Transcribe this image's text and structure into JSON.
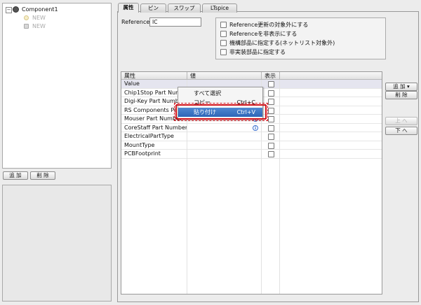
{
  "tree": {
    "root_label": "Component1",
    "children": [
      "NEW",
      "NEW"
    ]
  },
  "left_buttons": {
    "add": "追 加",
    "delete": "削 除"
  },
  "tabs": [
    {
      "label": "属性",
      "active": true
    },
    {
      "label": "ピン",
      "active": false
    },
    {
      "label": "スワップ",
      "active": false
    },
    {
      "label": "LTspice",
      "active": false
    }
  ],
  "reference": {
    "label": "Reference",
    "value": "IC"
  },
  "options": [
    "Reference更新の対象外にする",
    "Referenceを非表示にする",
    "機構部品に指定する(ネットリスト対象外)",
    "非実装部品に指定する"
  ],
  "table": {
    "headers": [
      "属性",
      "値",
      "表示"
    ],
    "rows": [
      {
        "name": "Value",
        "info": false
      },
      {
        "name": "Chip1Stop Part Number",
        "info": false
      },
      {
        "name": "Digi-Key Part Number",
        "info": false
      },
      {
        "name": "RS Components Part Number",
        "info": true
      },
      {
        "name": "Mouser Part Number",
        "info": true
      },
      {
        "name": "CoreStaff Part Number",
        "info": true
      },
      {
        "name": "ElectricalPartType",
        "info": false
      },
      {
        "name": "MountType",
        "info": false
      },
      {
        "name": "PCBFootprint",
        "info": false
      }
    ]
  },
  "right_buttons": {
    "add": "追 加 ▾",
    "delete": "削 除",
    "up": "上 へ",
    "down": "下 へ"
  },
  "context_menu": {
    "items": [
      {
        "label": "すべて選択",
        "shortcut": ""
      },
      {
        "label": "コピー",
        "shortcut": "Ctrl+C"
      },
      {
        "label": "貼り付け",
        "shortcut": "Ctrl+V"
      }
    ]
  },
  "colors": {
    "highlight": "#d4121a",
    "menu_selected": "#2d66b8"
  }
}
